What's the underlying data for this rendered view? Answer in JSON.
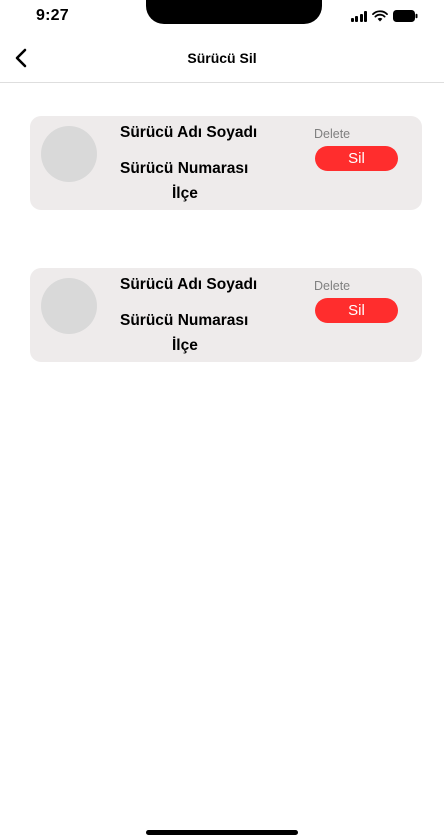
{
  "status_bar": {
    "time": "9:27",
    "icons": [
      "signal-icon",
      "wifi-icon",
      "battery-icon"
    ]
  },
  "header": {
    "title": "Sürücü Sil",
    "back_icon": "chevron-left-icon"
  },
  "drivers": [
    {
      "name": "Sürücü Adı Soyadı",
      "number": "Sürücü Numarası",
      "district": "İlçe",
      "delete_caption": "Delete",
      "delete_label": "Sil"
    },
    {
      "name": "Sürücü Adı Soyadı",
      "number": "Sürücü Numarası",
      "district": "İlçe",
      "delete_caption": "Delete",
      "delete_label": "Sil"
    }
  ],
  "colors": {
    "card_background": "#eeebeb",
    "avatar_placeholder": "#d9d9d9",
    "delete_button": "#ff2d2d",
    "delete_caption": "#808080"
  }
}
